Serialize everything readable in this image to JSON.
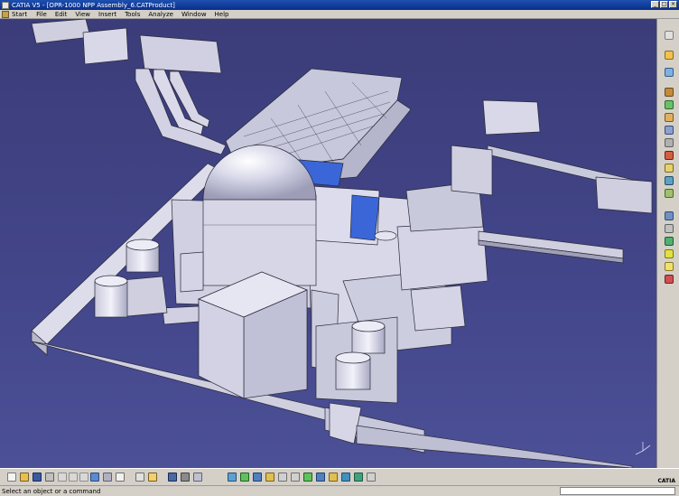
{
  "window": {
    "title": "CATIA V5 - [OPR-1000 NPP Assembly_6.CATProduct]"
  },
  "menu": {
    "items": [
      "Start",
      "File",
      "Edit",
      "View",
      "Insert",
      "Tools",
      "Analyze",
      "Window",
      "Help"
    ]
  },
  "viewport": {
    "background_top": "#3b3c79",
    "background_bottom": "#4c5096",
    "model_color": "#dcdcea",
    "highlight_color": "#3a66d8"
  },
  "right_toolbar": {
    "icons": [
      "sketch-icon",
      "pointer-icon",
      "sync-icon",
      "gear-icon",
      "part-icon",
      "product-icon",
      "render-icon",
      "material-icon",
      "clash-icon",
      "compass-icon",
      "measure-icon",
      "assembly-icon",
      "section-icon",
      "scene-icon",
      "view-icon",
      "layer-icon",
      "light-icon",
      "tools-icon"
    ]
  },
  "bottom_toolbar": {
    "icons": [
      "new-icon",
      "open-icon",
      "save-icon",
      "print-icon",
      "cut-icon",
      "copy-icon",
      "paste-icon",
      "undo-icon",
      "redo-icon",
      "whats-this-icon",
      "formula-icon",
      "comment-icon",
      "catalog-icon",
      "knowledge-icon",
      "table-icon",
      "fly-icon",
      "fit-all-icon",
      "pan-icon",
      "rotate-icon",
      "zoom-in-icon",
      "zoom-out-icon",
      "normal-view-icon",
      "quick-view-icon",
      "render-style-icon",
      "hide-show-icon",
      "swap-icon",
      "apply-material-icon"
    ]
  },
  "status": {
    "text": "Select an object or a command",
    "logo": "CATIA"
  }
}
